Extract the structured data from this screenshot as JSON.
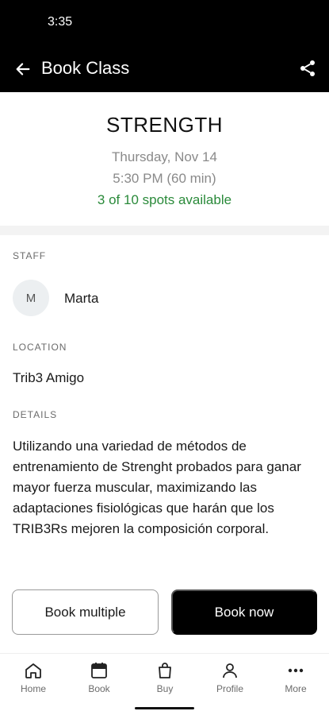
{
  "status_bar": {
    "time": "3:35"
  },
  "app_bar": {
    "title": "Book Class",
    "back_icon": "arrow-left-icon",
    "share_icon": "share-icon"
  },
  "class_info": {
    "name": "STRENGTH",
    "date": "Thursday, Nov 14",
    "time": "5:30 PM (60 min)",
    "spots": "3 of 10 spots available",
    "spots_color": "#2a8a3a"
  },
  "staff": {
    "label": "STAFF",
    "initial": "M",
    "name": "Marta"
  },
  "location": {
    "label": "LOCATION",
    "name": "Trib3 Amigo"
  },
  "details": {
    "label": "DETAILS",
    "text": "Utilizando una variedad de métodos de entrenamiento de Strenght probados para ganar mayor fuerza muscular, maximizando las adaptaciones fisiológicas que harán que los TRIB3Rs mejoren la composición corporal."
  },
  "actions": {
    "book_multiple": "Book multiple",
    "book_now": "Book now"
  },
  "bottom_nav": {
    "items": [
      {
        "label": "Home",
        "icon": "home-icon"
      },
      {
        "label": "Book",
        "icon": "calendar-icon"
      },
      {
        "label": "Buy",
        "icon": "shopping-bag-icon"
      },
      {
        "label": "Profile",
        "icon": "person-icon"
      },
      {
        "label": "More",
        "icon": "more-dots-icon"
      }
    ]
  }
}
